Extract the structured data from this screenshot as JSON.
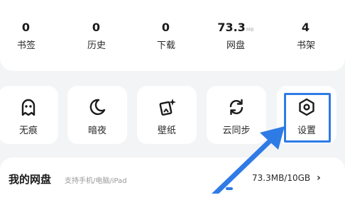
{
  "stats": [
    {
      "value": "0",
      "unit": "",
      "label": "书签"
    },
    {
      "value": "0",
      "unit": "",
      "label": "历史"
    },
    {
      "value": "0",
      "unit": "",
      "label": "下载"
    },
    {
      "value": "73.3",
      "unit": "MB",
      "label": "网盘"
    },
    {
      "value": "4",
      "unit": "",
      "label": "书架"
    }
  ],
  "tools": [
    {
      "label": "无痕",
      "icon": "ghost-icon"
    },
    {
      "label": "暗夜",
      "icon": "moon-icon"
    },
    {
      "label": "壁纸",
      "icon": "wallpaper-icon"
    },
    {
      "label": "云同步",
      "icon": "sync-icon"
    },
    {
      "label": "设置",
      "icon": "hexagon-settings-icon"
    }
  ],
  "disk": {
    "title": "我的网盘",
    "subtitle": "支持手机/电脑/iPad",
    "usage": "73.3MB/10GB",
    "chevron": "›"
  },
  "colors": {
    "accent": "#2f7be6",
    "card": "#ffffff",
    "background": "#f3f4f6"
  }
}
